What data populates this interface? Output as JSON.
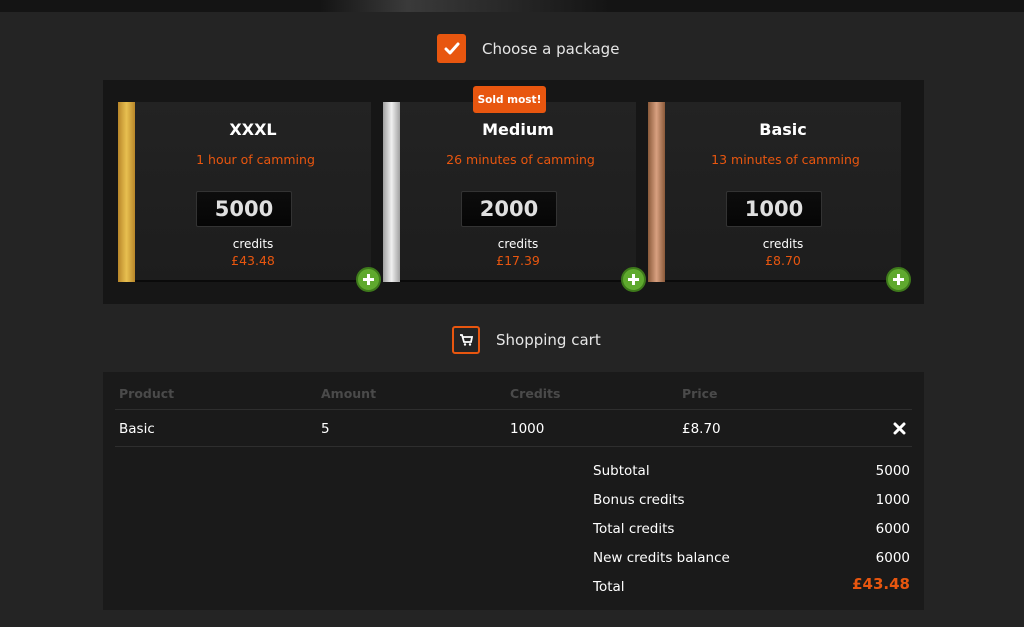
{
  "sections": {
    "choose_package": "Choose a package",
    "shopping_cart": "Shopping cart"
  },
  "badge": "Sold most!",
  "packages": [
    {
      "name": "XXXL",
      "description": "1 hour of camming",
      "credits": "5000",
      "credits_label": "credits",
      "price": "£43.48",
      "stripe_color": "#d4a73a"
    },
    {
      "name": "Medium",
      "description": "26 minutes of camming",
      "credits": "2000",
      "credits_label": "credits",
      "price": "£17.39",
      "stripe_color": "#cfcfcf"
    },
    {
      "name": "Basic",
      "description": "13 minutes of camming",
      "credits": "1000",
      "credits_label": "credits",
      "price": "£8.70",
      "stripe_color": "#b88060"
    }
  ],
  "cart": {
    "columns": [
      "Product",
      "Amount",
      "Credits",
      "Price"
    ],
    "rows": [
      {
        "product": "Basic",
        "amount": "5",
        "credits": "1000",
        "price": "£8.70"
      }
    ],
    "summary": {
      "subtotal_label": "Subtotal",
      "subtotal": "5000",
      "bonus_label": "Bonus credits",
      "bonus": "1000",
      "total_credits_label": "Total credits",
      "total_credits": "6000",
      "new_balance_label": "New credits balance",
      "new_balance": "6000",
      "total_label": "Total",
      "total": "£43.48"
    }
  },
  "colors": {
    "accent": "#e8560f",
    "add_button": "#5fa92e",
    "background": "#242424"
  }
}
